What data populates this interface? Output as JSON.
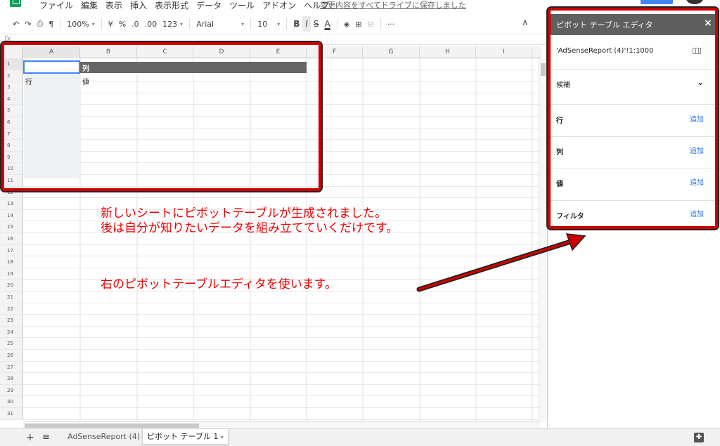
{
  "menu": {
    "items": [
      "ファイル",
      "編集",
      "表示",
      "挿入",
      "表示形式",
      "データ",
      "ツール",
      "アドオン",
      "ヘルプ"
    ],
    "save_status": "変更内容をすべてドライブに保存しました"
  },
  "toolbar": {
    "zoom": "100%",
    "currency": "¥",
    "percent": "%",
    "dec_less": ".0",
    "dec_more": ".00",
    "format_more": "123",
    "font": "Arial",
    "font_size": "10",
    "bold": "B",
    "italic": "I",
    "strike": "S",
    "text_color": "A",
    "more": "···",
    "collapse": "∧"
  },
  "formula_bar": {
    "fx": "fx"
  },
  "grid": {
    "columns": [
      "A",
      "B",
      "C",
      "D",
      "E",
      "F",
      "G",
      "H",
      "I"
    ],
    "rows": [
      "1",
      "2",
      "3",
      "4",
      "5",
      "6",
      "7",
      "8",
      "9",
      "10",
      "11",
      "12",
      "13",
      "14",
      "15",
      "16",
      "17",
      "18",
      "19",
      "20",
      "21",
      "22",
      "23",
      "24",
      "25",
      "26",
      "27",
      "28",
      "29",
      "30",
      "31"
    ],
    "cells": {
      "b1": "列",
      "a2": "行",
      "b2": "値"
    }
  },
  "sheets": {
    "tabs": [
      {
        "label": "AdSenseReport (4)"
      },
      {
        "label": "ピボット テーブル 1"
      }
    ]
  },
  "panel": {
    "title": "ピボット テーブル エディタ",
    "close": "×",
    "range": "'AdSenseReport (4)'!1:1000",
    "suggestions": "候補",
    "sections": [
      {
        "label": "行",
        "add": "追加"
      },
      {
        "label": "列",
        "add": "追加"
      },
      {
        "label": "値",
        "add": "追加"
      },
      {
        "label": "フィルタ",
        "add": "追加"
      }
    ]
  },
  "annotations": {
    "line1": "新しいシートにピボットテーブルが生成されました。",
    "line2": "後は自分が知りたいデータを組み立てていくだけです。",
    "line3": "右のピボットテーブルエディタを使います。"
  },
  "colors": {
    "accent": "#4285f4",
    "annotation_red": "#e00000",
    "panel_header": "#5f5f5f",
    "link_blue": "#1a73e8"
  }
}
